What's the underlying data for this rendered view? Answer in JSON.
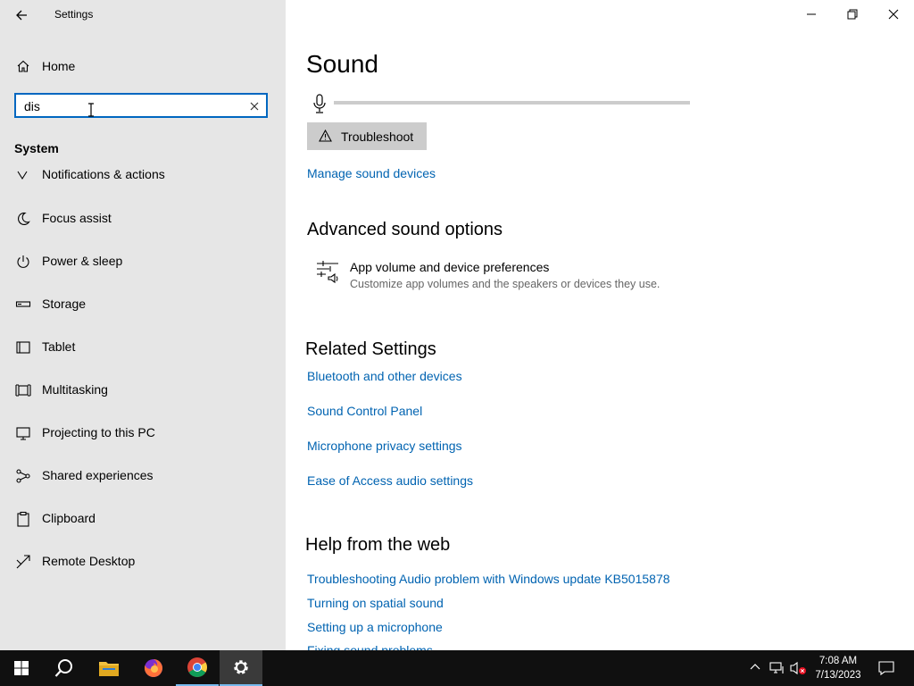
{
  "window": {
    "title": "Settings"
  },
  "sidebar": {
    "home_label": "Home",
    "search_value": "dis",
    "section_title": "System",
    "clipped_item": "Notifications & actions",
    "items": [
      {
        "label": "Focus assist",
        "icon": "moon-icon"
      },
      {
        "label": "Power & sleep",
        "icon": "power-icon"
      },
      {
        "label": "Storage",
        "icon": "storage-icon"
      },
      {
        "label": "Tablet",
        "icon": "tablet-icon"
      },
      {
        "label": "Multitasking",
        "icon": "multitasking-icon"
      },
      {
        "label": "Projecting to this PC",
        "icon": "projector-icon"
      },
      {
        "label": "Shared experiences",
        "icon": "shared-icon"
      },
      {
        "label": "Clipboard",
        "icon": "clipboard-icon"
      },
      {
        "label": "Remote Desktop",
        "icon": "remote-desktop-icon"
      }
    ]
  },
  "main": {
    "title": "Sound",
    "mic_level": 0,
    "troubleshoot_label": "Troubleshoot",
    "manage_devices_link": "Manage sound devices",
    "advanced": {
      "heading": "Advanced sound options",
      "item_title": "App volume and device preferences",
      "item_desc": "Customize app volumes and the speakers or devices they use."
    },
    "related": {
      "heading": "Related Settings",
      "links": [
        "Bluetooth and other devices",
        "Sound Control Panel",
        "Microphone privacy settings",
        "Ease of Access audio settings"
      ]
    },
    "help": {
      "heading": "Help from the web",
      "links": [
        "Troubleshooting Audio problem with Windows update KB5015878",
        "Turning on spatial sound",
        "Setting up a microphone",
        "Fixing sound problems"
      ]
    }
  },
  "taskbar": {
    "time": "7:08 AM",
    "date": "7/13/2023",
    "accent": "#76b9ed"
  },
  "colors": {
    "link": "#0063b1",
    "accent": "#0067c0",
    "sidebar_bg": "#e6e6e6"
  }
}
